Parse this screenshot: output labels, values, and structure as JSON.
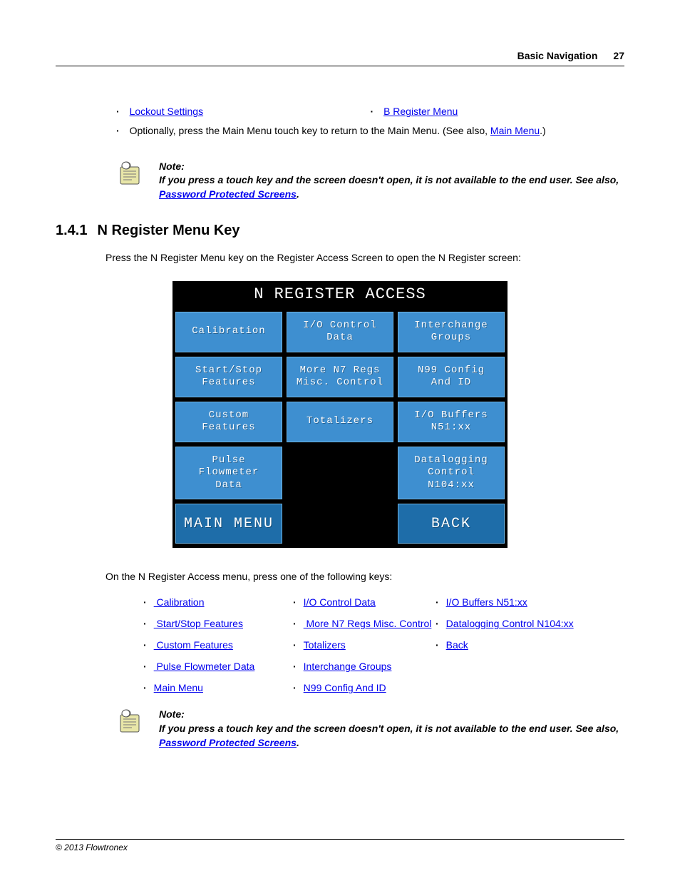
{
  "header": {
    "title": "Basic Navigation",
    "page": "27"
  },
  "topLinks": {
    "left": "Lockout Settings",
    "right": "B Register Menu"
  },
  "optionalText": {
    "prefix": "Optionally, press the Main Menu touch key to return to the Main Menu. (See also, ",
    "link": "Main Menu",
    "suffix": ".)"
  },
  "note1": {
    "label": "Note:",
    "body_a": "If you press a touch key and the screen doesn't open,  it is not available to the end user. See also, ",
    "link": "Password Protected Screens",
    "body_b": "."
  },
  "section": {
    "num": "1.4.1",
    "title": "N Register Menu Key"
  },
  "intro": "Press the N Register Menu key on the Register Access Screen to open the N Register screen:",
  "touchscreen": {
    "title": "N REGISTER ACCESS",
    "buttons": [
      "Calibration",
      "I/O Control\nData",
      "Interchange\nGroups",
      "Start/Stop\nFeatures",
      "More N7 Regs\nMisc. Control",
      "N99 Config\nAnd ID",
      "Custom\nFeatures",
      "Totalizers",
      "I/O Buffers\nN51:xx",
      "Pulse\nFlowmeter\nData",
      "",
      "Datalogging\nControl\nN104:xx",
      "MAIN MENU",
      "",
      "BACK"
    ]
  },
  "afterFigure": "On the N Register Access menu, press one of the following keys:",
  "links": {
    "c0": [
      " Calibration",
      " Start/Stop Features",
      " Custom Features",
      " Pulse Flowmeter Data",
      "Main Menu"
    ],
    "c1": [
      "I/O Control Data",
      " More N7 Regs Misc. Control",
      "Totalizers",
      "Interchange Groups",
      "N99 Config And ID"
    ],
    "c2": [
      "I/O Buffers N51:xx",
      "Datalogging Control N104:xx",
      "Back"
    ]
  },
  "note2": {
    "label": "Note:",
    "body_a": "If you press a touch key and the screen doesn't open,  it is not available to the end user. See also, ",
    "link": "Password Protected Screens",
    "body_b": "."
  },
  "footer": "© 2013 Flowtronex"
}
